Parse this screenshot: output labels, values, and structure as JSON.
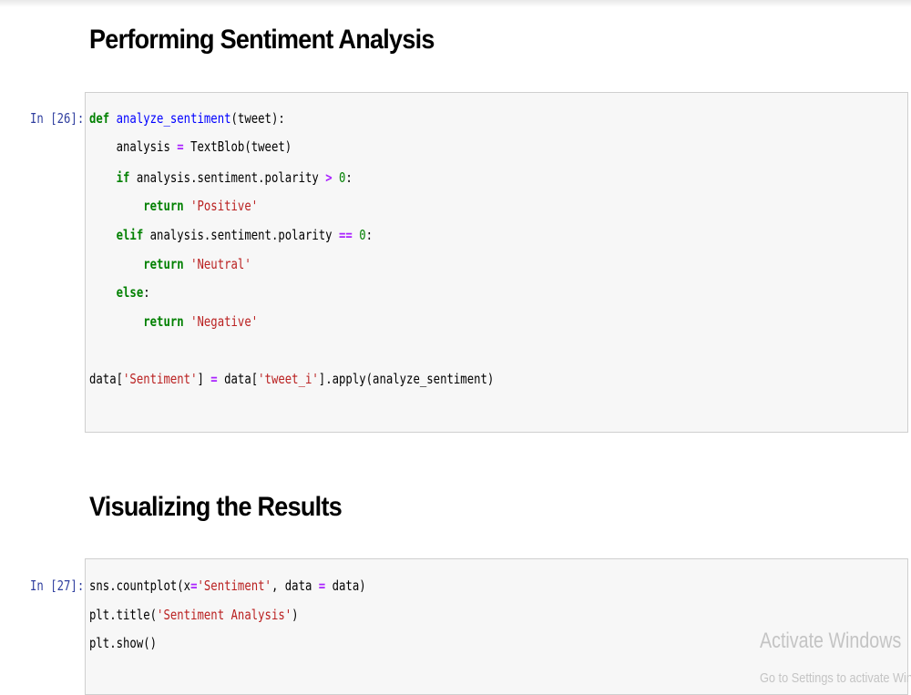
{
  "sections": [
    {
      "heading": "Performing Sentiment Analysis",
      "prompt": "In [26]:",
      "code": {
        "l1": {
          "kw": "def",
          "fn": "analyze_sentiment",
          "rest": "(tweet):"
        },
        "l2": {
          "a": "analysis",
          "op": "=",
          "b": "TextBlob(tweet)"
        },
        "l3": {
          "kw": "if",
          "a": "analysis.sentiment.polarity",
          "op": ">",
          "num": "0",
          "colon": ":"
        },
        "l4": {
          "kw": "return",
          "str": "'Positive'"
        },
        "l5": {
          "kw": "elif",
          "a": "analysis.sentiment.polarity",
          "op": "==",
          "num": "0",
          "colon": ":"
        },
        "l6": {
          "kw": "return",
          "str": "'Neutral'"
        },
        "l7": {
          "kw": "else",
          "colon": ":"
        },
        "l8": {
          "kw": "return",
          "str": "'Negative'"
        },
        "l10": {
          "a": "data[",
          "s1": "'Sentiment'",
          "b": "]",
          "op": "=",
          "c": "data[",
          "s2": "'tweet_i'",
          "d": "].apply(analyze_sentiment)"
        }
      }
    },
    {
      "heading": "Visualizing the Results",
      "prompt": "In [27]:",
      "code": {
        "l1": {
          "a": "sns.countplot(x",
          "op1": "=",
          "s1": "'Sentiment'",
          "b": ", data ",
          "op2": "=",
          "c": " data)"
        },
        "l2": {
          "a": "plt.title(",
          "s1": "'Sentiment Analysis'",
          "b": ")"
        },
        "l3": {
          "a": "plt.show()"
        }
      }
    }
  ],
  "watermark": {
    "line1": "Activate Windows",
    "line2": "Go to Settings to activate Windows."
  }
}
